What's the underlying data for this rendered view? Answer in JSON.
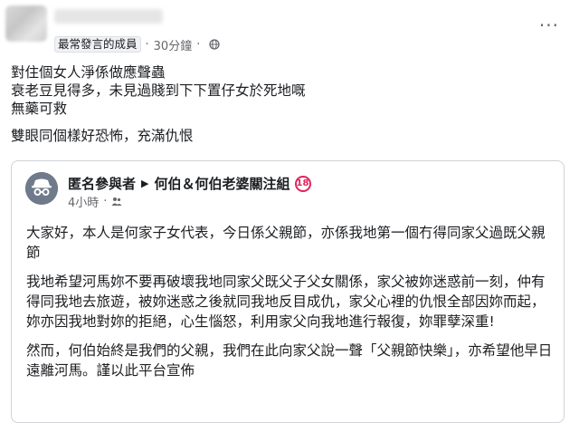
{
  "post": {
    "role_badge": "最常發言的成員",
    "separator": "·",
    "time": "30分鐘",
    "more_label": "···",
    "lines": [
      "對住個女人淨係做應聲蟲",
      "衰老豆見得多，未見過賤到下下置仔女於死地嘅",
      "無藥可救"
    ],
    "extra_line": "雙眼同個樣好恐怖，充滿仇恨"
  },
  "shared": {
    "author": "匿名參與者",
    "arrow": "▶",
    "group": "何伯＆何伯老婆關注組",
    "age_rating": "18",
    "time": "4小時",
    "separator": "·",
    "paragraphs": [
      "大家好，本人是何家子女代表，今日係父親節，亦係我地第一個冇得同家父過既父親節",
      "我地希望河馬妳不要再破壞我地同家父既父子父女關係，家父被妳迷惑前一刻，仲有得同我地去旅遊，被妳迷惑之後就同我地反目成仇，家父心裡的仇恨全部因妳而起，妳亦因我地對妳的拒絕，心生惱怒，利用家父向我地進行報復，妳罪孽深重!",
      "然而，何伯始終是我們的父親，我們在此向家父說一聲「父親節快樂」，亦希望他早日遠離河馬。謹以此平台宣佈"
    ]
  },
  "colors": {
    "text": "#1c1e21",
    "meta": "#65676b",
    "age_badge": "#e0245e",
    "card_border": "#cfd3d8"
  },
  "icons": [
    "globe-icon",
    "group-privacy-icon",
    "anonymous-icon",
    "more-options-icon"
  ]
}
